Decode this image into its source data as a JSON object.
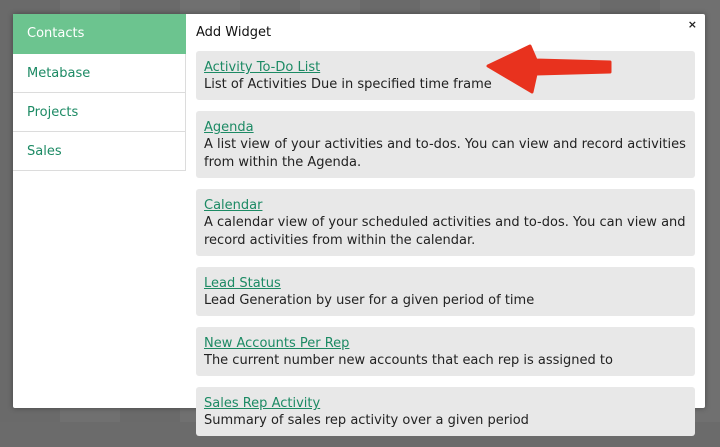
{
  "sidebar": {
    "items": [
      {
        "label": "Contacts",
        "active": true
      },
      {
        "label": "Metabase",
        "active": false
      },
      {
        "label": "Projects",
        "active": false
      },
      {
        "label": "Sales",
        "active": false
      }
    ]
  },
  "modal": {
    "title": "Add Widget",
    "close_symbol": "×"
  },
  "widgets": [
    {
      "name": "Activity To-Do List",
      "description": "List of Activities Due in specified time frame"
    },
    {
      "name": "Agenda",
      "description": "A list view of your activities and to-dos. You can view and record activities from within the Agenda."
    },
    {
      "name": "Calendar",
      "description": "A calendar view of your scheduled activities and to-dos. You can view and record activities from within the calendar."
    },
    {
      "name": "Lead Status",
      "description": "Lead Generation by user for a given period of time"
    },
    {
      "name": "New Accounts Per Rep",
      "description": "The current number new accounts that each rep is assigned to"
    },
    {
      "name": "Sales Rep Activity",
      "description": "Summary of sales rep activity over a given period"
    }
  ],
  "colors": {
    "accent": "#6cc48f",
    "link": "#1c8a64",
    "annotation_arrow": "#e8321e"
  },
  "annotation": {
    "icon": "red-arrow-icon"
  }
}
